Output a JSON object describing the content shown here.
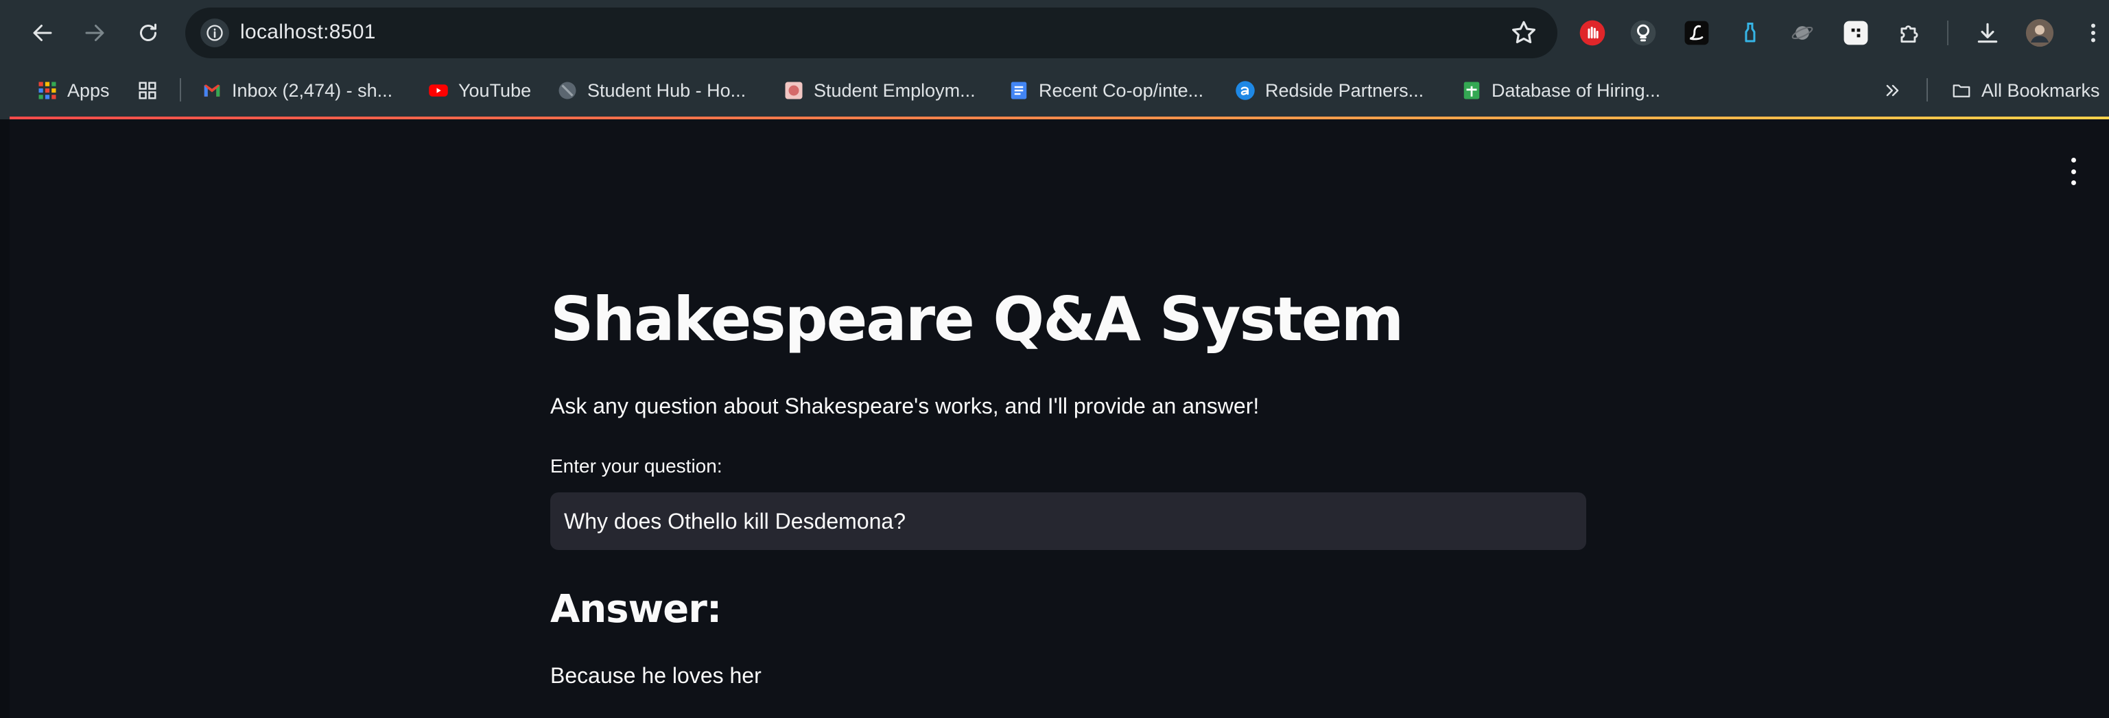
{
  "browser": {
    "url": "localhost:8501",
    "bookmarks": [
      {
        "label": "Apps",
        "icon": "apps-grid-icon"
      },
      {
        "label": "Inbox (2,474) - sh...",
        "icon": "gmail-icon"
      },
      {
        "label": "YouTube",
        "icon": "youtube-icon"
      },
      {
        "label": "Student Hub - Ho...",
        "icon": "student-hub-icon"
      },
      {
        "label": "Student Employm...",
        "icon": "student-employment-icon"
      },
      {
        "label": "Recent Co-op/inte...",
        "icon": "google-docs-icon"
      },
      {
        "label": "Redside Partners...",
        "icon": "redside-icon"
      },
      {
        "label": "Database of Hiring...",
        "icon": "google-sheets-icon"
      }
    ],
    "all_bookmarks_label": "All Bookmarks",
    "colors": {
      "toolbar_bg": "#263036",
      "omnibox_bg": "#161d21",
      "accent_gradient": [
        "#ff4b4b",
        "#ffd24b"
      ]
    }
  },
  "app": {
    "title": "Shakespeare Q&A System",
    "subtitle": "Ask any question about Shakespeare's works, and I'll provide an answer!",
    "question_label": "Enter your question:",
    "question_value": "Why does Othello kill Desdemona?",
    "answer_heading": "Answer:",
    "answer_text": "Because he loves her",
    "colors": {
      "background": "#0e1117",
      "input_bg": "#262730",
      "text": "#fafafa"
    }
  }
}
